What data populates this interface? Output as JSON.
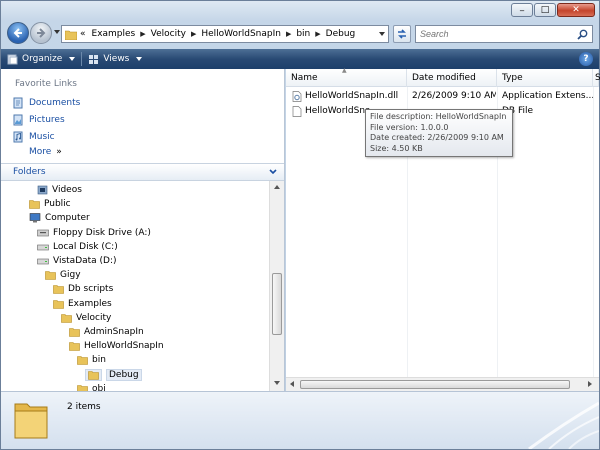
{
  "window": {
    "minimize": "‒",
    "maximize": "□",
    "close": "✕"
  },
  "address": {
    "prefix": "«",
    "crumbs": [
      "Examples",
      "Velocity",
      "HelloWorldSnapIn",
      "bin",
      "Debug"
    ],
    "search_placeholder": "Search"
  },
  "toolbar": {
    "organize": "Organize",
    "views": "Views",
    "help": "?"
  },
  "nav": {
    "favorites_header": "Favorite Links",
    "favorites": [
      "Documents",
      "Pictures",
      "Music"
    ],
    "more": "More",
    "more_glyph": "»",
    "folders_header": "Folders",
    "tree": [
      {
        "label": "Videos",
        "icon": "videos-icon",
        "indent": 1
      },
      {
        "label": "Public",
        "icon": "folder-icon",
        "indent": 0
      },
      {
        "label": "Computer",
        "icon": "computer-icon",
        "indent": 0
      },
      {
        "label": "Floppy Disk Drive (A:)",
        "icon": "floppy-icon",
        "indent": 1
      },
      {
        "label": "Local Disk (C:)",
        "icon": "drive-icon",
        "indent": 1
      },
      {
        "label": "VistaData (D:)",
        "icon": "drive-icon",
        "indent": 1
      },
      {
        "label": "Gigy",
        "icon": "folder-icon",
        "indent": 2
      },
      {
        "label": "Db scripts",
        "icon": "folder-icon",
        "indent": 3
      },
      {
        "label": "Examples",
        "icon": "folder-icon",
        "indent": 3
      },
      {
        "label": "Velocity",
        "icon": "folder-icon",
        "indent": 4
      },
      {
        "label": "AdminSnapIn",
        "icon": "folder-icon",
        "indent": 5
      },
      {
        "label": "HelloWorldSnapIn",
        "icon": "folder-icon",
        "indent": 5
      },
      {
        "label": "bin",
        "icon": "folder-icon",
        "indent": 6
      },
      {
        "label": "Debug",
        "icon": "folder-icon",
        "indent": 7,
        "selected": true
      },
      {
        "label": "obj",
        "icon": "folder-icon",
        "indent": 6
      }
    ]
  },
  "columns": {
    "name": "Name",
    "date": "Date modified",
    "type": "Type",
    "size": "S"
  },
  "files": [
    {
      "name": "HelloWorldSnapIn.dll",
      "date": "2/26/2009 9:10 AM",
      "type": "Application Extens..."
    },
    {
      "name": "HelloWorldSna",
      "date": "",
      "type": "DB File"
    }
  ],
  "tooltip": [
    "File description: HelloWorldSnapIn",
    "File version: 1.0.0.0",
    "Date created: 2/26/2009 9:10 AM",
    "Size: 4.50 KB"
  ],
  "details": {
    "count": "2 items"
  }
}
